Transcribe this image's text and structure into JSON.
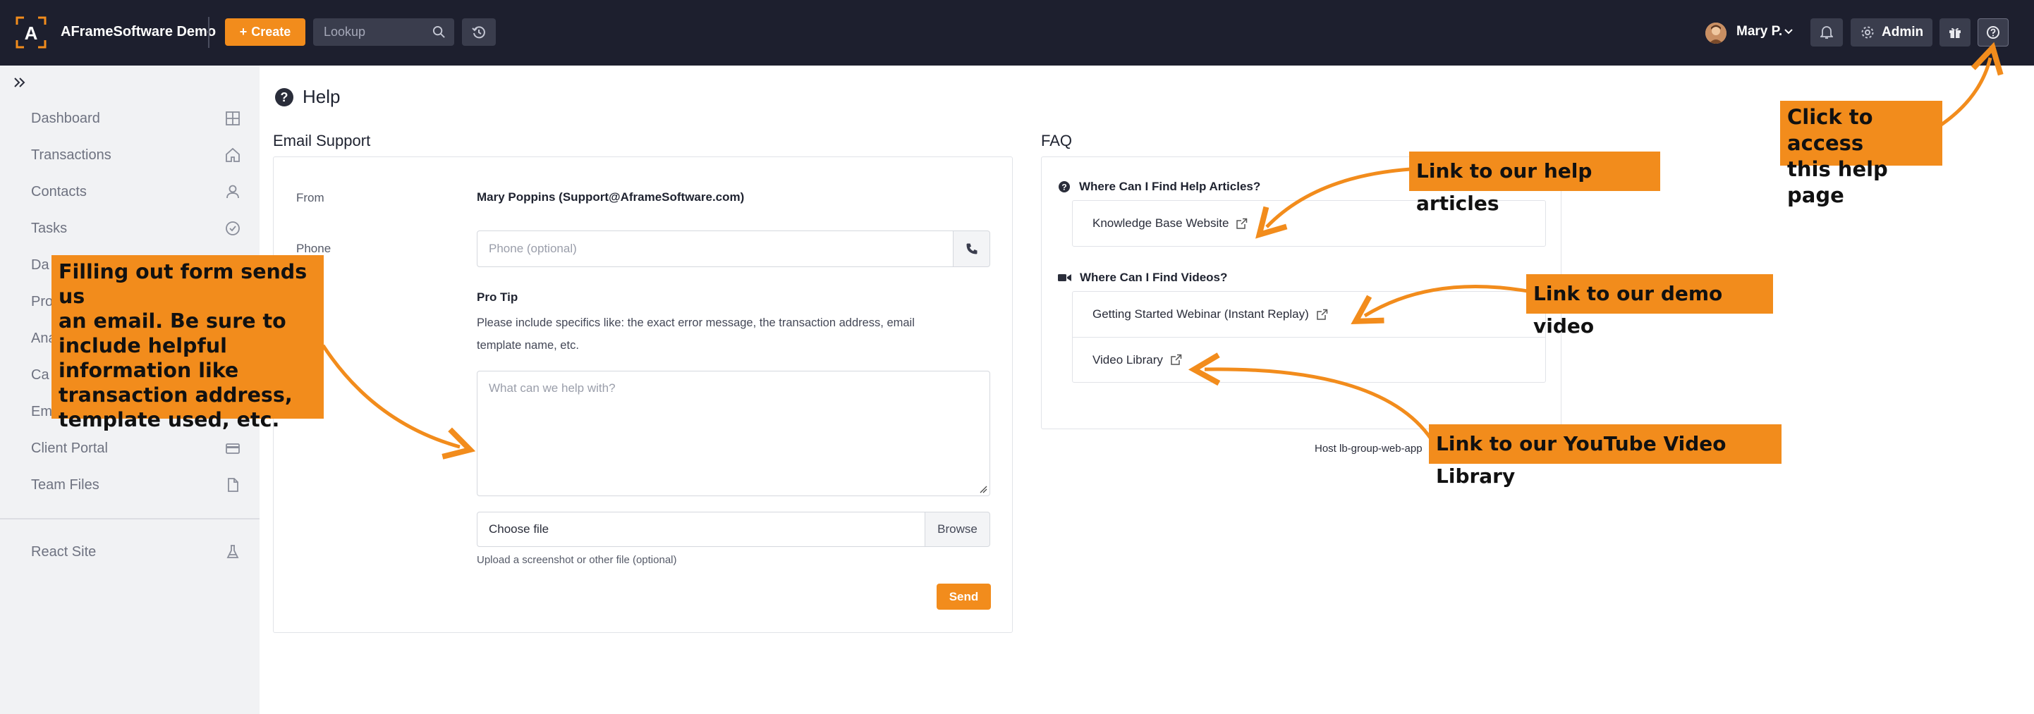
{
  "topbar": {
    "logo_letter": "A",
    "app_title": "AFrameSoftware Demo",
    "create_label": "Create",
    "lookup_placeholder": "Lookup",
    "user_name": "Mary P.",
    "admin_label": "Admin"
  },
  "sidebar": {
    "items": [
      {
        "label": "Dashboard",
        "icon": "grid-icon"
      },
      {
        "label": "Transactions",
        "icon": "home-icon"
      },
      {
        "label": "Contacts",
        "icon": "person-icon"
      },
      {
        "label": "Tasks",
        "icon": "check-circle-icon"
      },
      {
        "label": "Da",
        "icon": ""
      },
      {
        "label": "Pro",
        "icon": ""
      },
      {
        "label": "Ana",
        "icon": ""
      },
      {
        "label": "Ca",
        "icon": ""
      },
      {
        "label": "Em",
        "icon": ""
      },
      {
        "label": "Client Portal",
        "icon": "card-icon"
      },
      {
        "label": "Team Files",
        "icon": "file-icon"
      }
    ],
    "bottom_item": {
      "label": "React Site",
      "icon": "flask-icon"
    }
  },
  "page": {
    "title": "Help"
  },
  "email_support": {
    "title": "Email Support",
    "from_label": "From",
    "from_value": "Mary Poppins (Support@AframeSoftware.com)",
    "phone_label": "Phone",
    "phone_placeholder": "Phone (optional)",
    "protip_title": "Pro Tip",
    "protip_line1": "Please include specifics like: the exact error message, the transaction address, email",
    "protip_line2": "template name, etc.",
    "message_placeholder": "What can we help with?",
    "file_choose": "Choose file",
    "file_browse": "Browse",
    "file_help": "Upload a screenshot or other file (optional)",
    "send_label": "Send"
  },
  "faq": {
    "title": "FAQ",
    "q1": "Where Can I Find Help Articles?",
    "q1_links": [
      "Knowledge Base Website"
    ],
    "q2": "Where Can I Find Videos?",
    "q2_links": [
      "Getting Started Webinar (Instant Replay)",
      "Video Library"
    ],
    "host_text": "Host lb-group-web-app"
  },
  "annotations": {
    "help_page": [
      "Click to access",
      "this help page"
    ],
    "help_articles": "Link to our help articles",
    "demo_video": "Link to our demo video",
    "youtube": "Link to our YouTube Video Library",
    "form_note": [
      "Filling out form sends us",
      "an email. Be sure to",
      "include helpful",
      "information like",
      "transaction address,",
      "template used, etc."
    ]
  },
  "colors": {
    "topbar": "#1d1f2e",
    "accent": "#f28c1c",
    "sidebar_bg": "#f1f2f4"
  }
}
